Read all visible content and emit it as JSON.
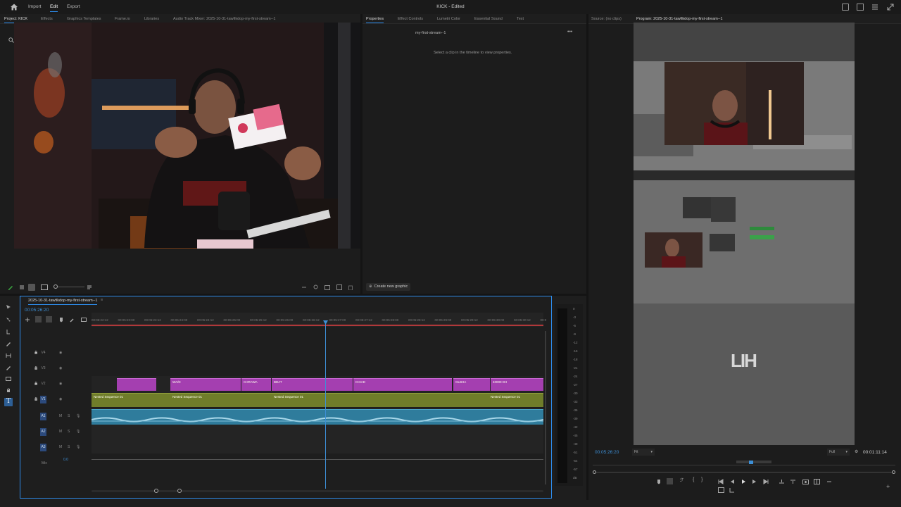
{
  "window": {
    "title": "KICK - Edited"
  },
  "top_menu": {
    "import": "Import",
    "edit": "Edit",
    "export": "Export"
  },
  "source_tabs": [
    "Project: KICK",
    "Effects",
    "Graphics Templates",
    "Frame.io",
    "Libraries",
    "Audio Track Mixer: 2025-10-31-tawfikdop-my-first-stream--1"
  ],
  "properties_tabs": [
    "Properties",
    "Effect Controls",
    "Lumetri Color",
    "Essential Sound",
    "Text"
  ],
  "properties": {
    "sequence_name": "my-first-stream--1",
    "hint": "Select a clip in the timeline to view properties.",
    "create_graphic": "Create new graphic"
  },
  "monitor_tabs": [
    "Source: (no clips)",
    "Program: 2025-10-31-tawfikdop-my-first-stream--1"
  ],
  "timeline": {
    "sequence_tab": "2025-10-31-tawfikdop-my-first-stream--1",
    "timecode": "00:05:26:20",
    "ruler_ticks": [
      "00:05:22:12",
      "00:05:23:00",
      "00:05:23:12",
      "00:05:24:00",
      "00:05:24:12",
      "00:05:25:00",
      "00:05:25:12",
      "00:05:26:00",
      "00:05:26:12",
      "00:05:27:00",
      "00:05:27:12",
      "00:05:28:00",
      "00:05:28:12",
      "00:05:29:00",
      "00:05:29:12",
      "00:05:30:00",
      "00:05:30:12",
      "00:0"
    ],
    "video_tracks": [
      "V4",
      "V3",
      "V2",
      "V1"
    ],
    "audio_tracks": [
      "A1",
      "A2",
      "A3"
    ],
    "mix_label": "Mix",
    "mix_value": "0.0",
    "v2_clip_labels": [
      "WA/D",
      "CHRAWA",
      "BDAT",
      "ICHAD",
      "GLBHA",
      "40000 DH"
    ],
    "v1_clip_labels": [
      "Nested Sequence 01",
      "Nested Sequence 01",
      "Nested Sequence 01",
      "Nested Sequence 01"
    ]
  },
  "meter_scale": [
    "0",
    "-3",
    "-6",
    "-9",
    "-12",
    "-15",
    "-18",
    "-21",
    "-24",
    "-27",
    "-30",
    "-33",
    "-36",
    "-39",
    "-42",
    "-45",
    "-48",
    "-51",
    "-54",
    "-57",
    "dB"
  ],
  "program": {
    "timecode": "00:05:26:20",
    "fit": "Fit",
    "quality": "Full",
    "duration": "00:01:11:14",
    "watermark": "LIH"
  },
  "colors": {
    "accent": "#2d8ceb",
    "purple_clip": "#a43fb0",
    "olive_clip": "#6f7d2a",
    "audio_clip": "#2f7c9c",
    "timecode": "#3d8fd6"
  },
  "icons": [
    "home-icon",
    "search-icon",
    "pen-icon",
    "list-view-icon",
    "icon-view-icon",
    "selection-tool-icon",
    "razor-tool-icon",
    "hand-tool-icon",
    "type-tool-icon",
    "wrench-icon",
    "eye-icon",
    "lock-icon",
    "mic-icon",
    "play-icon",
    "step-back-icon",
    "step-forward-icon",
    "camera-icon",
    "settings-icon",
    "maximize-icon",
    "share-icon",
    "menu-icon"
  ]
}
